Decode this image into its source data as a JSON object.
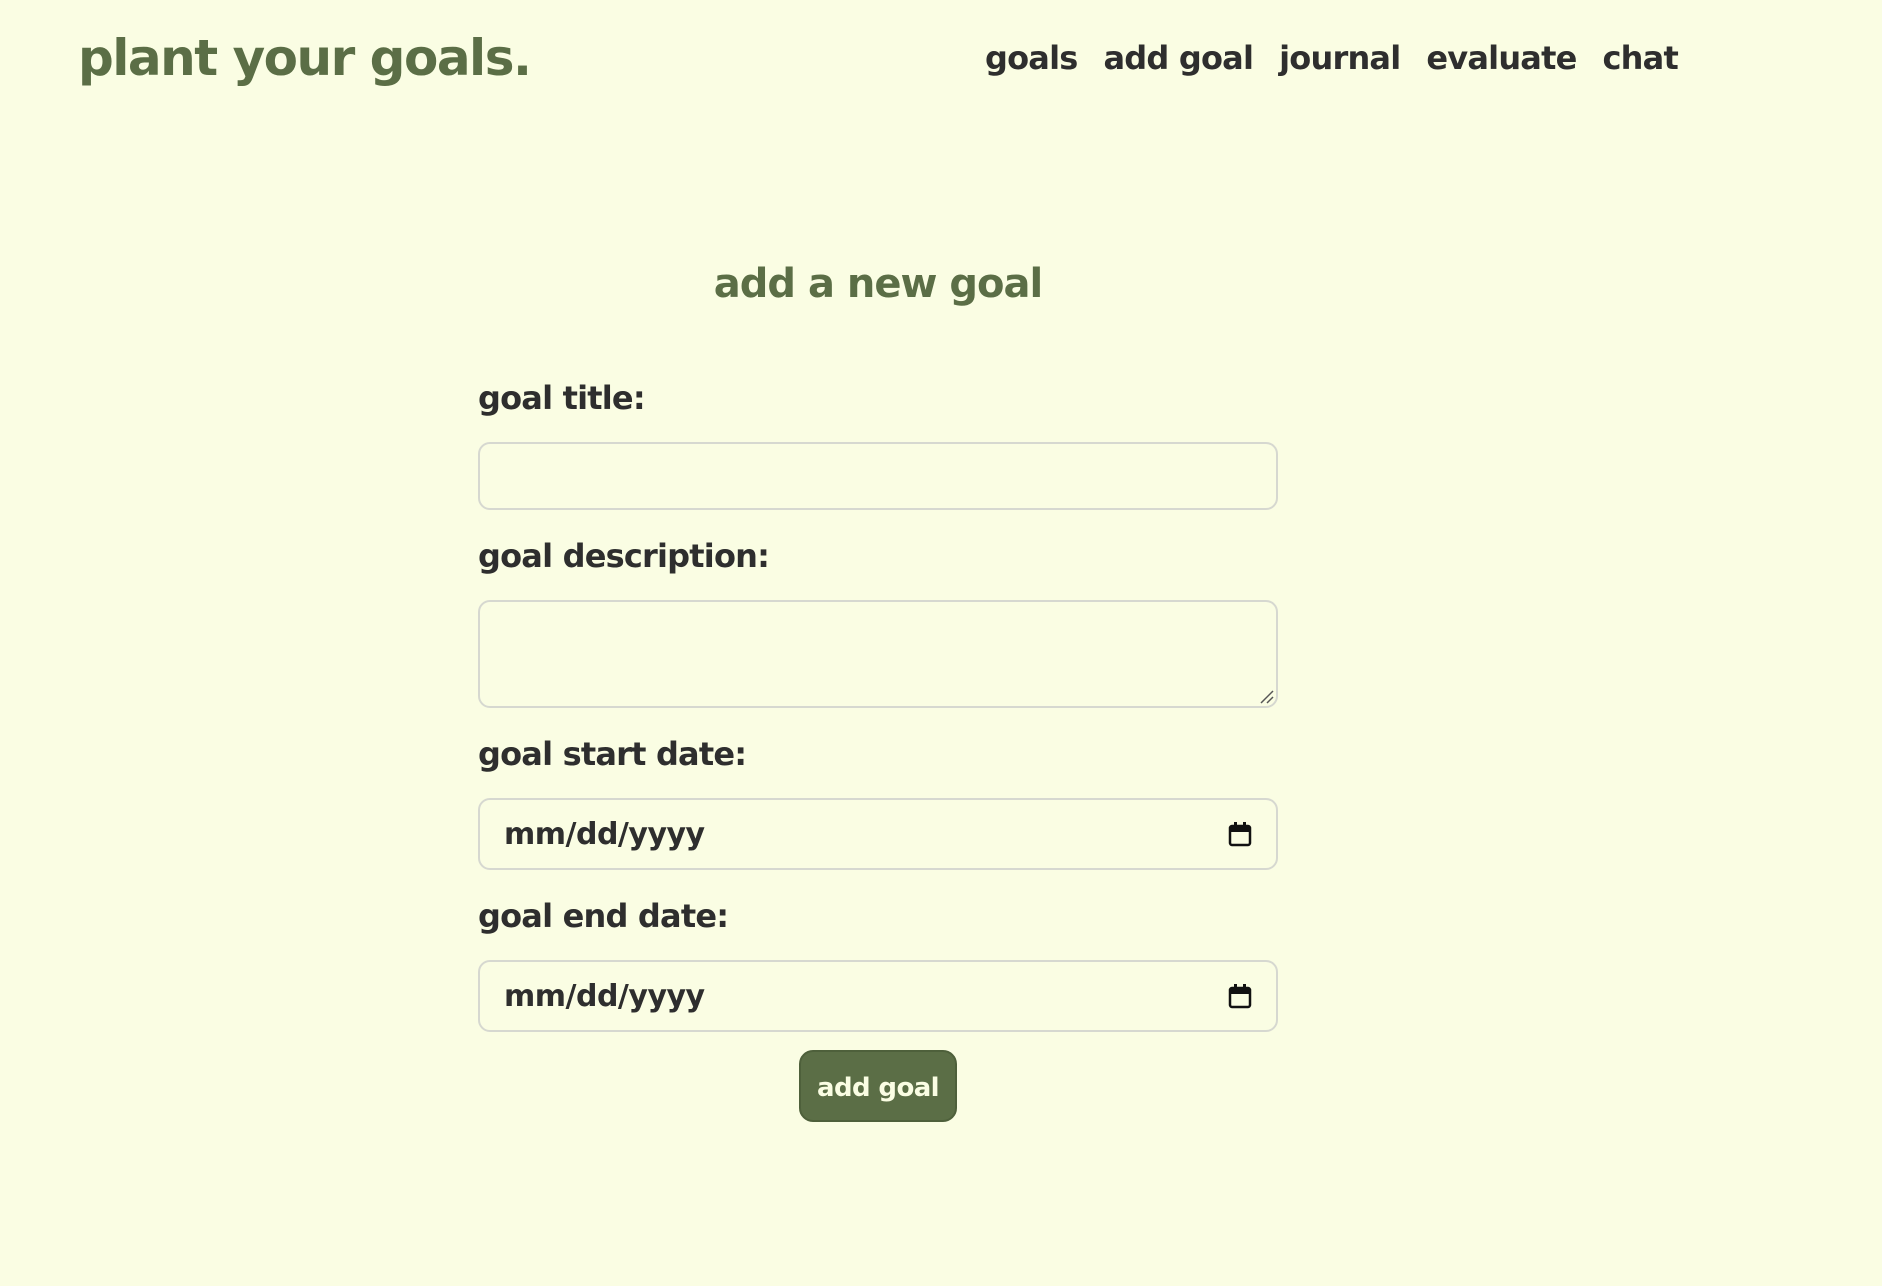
{
  "header": {
    "brand": "plant your goals.",
    "nav": [
      "goals",
      "add goal",
      "journal",
      "evaluate",
      "chat"
    ]
  },
  "form": {
    "title": "add a new goal",
    "title_label": "goal title:",
    "title_value": "",
    "description_label": "goal description:",
    "description_value": "",
    "start_label": "goal start date:",
    "start_placeholder": "mm/dd/yyyy",
    "end_label": "goal end date:",
    "end_placeholder": "mm/dd/yyyy",
    "submit_label": "add goal"
  },
  "colors": {
    "background": "#fafde3",
    "accent": "#5b6e46",
    "text": "#2e2e2e",
    "border": "#d6d8d0"
  },
  "icons": {
    "date_picker": "calendar-icon",
    "textarea_resize": "resize-grip-icon"
  }
}
